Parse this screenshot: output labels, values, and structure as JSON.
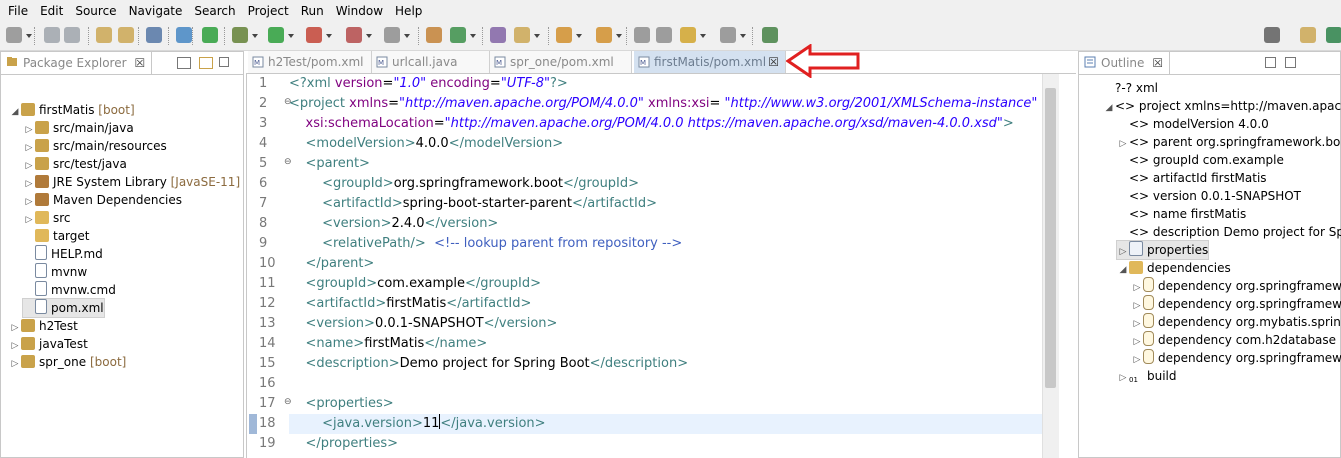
{
  "menu": [
    "File",
    "Edit",
    "Source",
    "Navigate",
    "Search",
    "Project",
    "Run",
    "Window",
    "Help"
  ],
  "package_explorer": {
    "title": "Package Explorer",
    "close": "☒",
    "items": [
      {
        "label": "firstMatis",
        "deco": " [boot]",
        "twisty": "◢",
        "icon": "project-icon"
      },
      {
        "label": "src/main/java",
        "deco": "",
        "twisty": "▷",
        "icon": "source-folder-icon"
      },
      {
        "label": "src/main/resources",
        "deco": "",
        "twisty": "▷",
        "icon": "source-folder-icon"
      },
      {
        "label": "src/test/java",
        "deco": "",
        "twisty": "▷",
        "icon": "source-folder-icon"
      },
      {
        "label": "JRE System Library",
        "deco": " [JavaSE-11]",
        "twisty": "▷",
        "icon": "library-icon"
      },
      {
        "label": "Maven Dependencies",
        "deco": "",
        "twisty": "▷",
        "icon": "library-icon"
      },
      {
        "label": "src",
        "deco": "",
        "twisty": "▷",
        "icon": "folder-icon"
      },
      {
        "label": "target",
        "deco": "",
        "twisty": "",
        "icon": "folder-icon"
      },
      {
        "label": "HELP.md",
        "deco": "",
        "twisty": "",
        "icon": "file-icon"
      },
      {
        "label": "mvnw",
        "deco": "",
        "twisty": "",
        "icon": "file-icon"
      },
      {
        "label": "mvnw.cmd",
        "deco": "",
        "twisty": "",
        "icon": "file-icon"
      },
      {
        "label": "pom.xml",
        "deco": "",
        "twisty": "",
        "icon": "xml-file-icon"
      },
      {
        "label": "h2Test",
        "deco": "",
        "twisty": "▷",
        "icon": "project-icon"
      },
      {
        "label": "javaTest",
        "deco": "",
        "twisty": "▷",
        "icon": "project-icon"
      },
      {
        "label": "spr_one",
        "deco": " [boot]",
        "twisty": "▷",
        "icon": "project-icon"
      }
    ]
  },
  "editor_tabs": [
    {
      "label": "h2Test/pom.xml",
      "active": false
    },
    {
      "label": "urlcall.java",
      "active": false
    },
    {
      "label": "spr_one/pom.xml",
      "active": false
    },
    {
      "label": "firstMatis/pom.xml",
      "active": true
    }
  ],
  "editor_tab_close": "☒",
  "code_lines": [
    {
      "n": "1",
      "fold": "",
      "segs": [
        [
          "t",
          "<?xml "
        ],
        [
          "a",
          "version"
        ],
        [
          "",
          "="
        ],
        [
          "v",
          "\"1.0\""
        ],
        [
          "",
          " "
        ],
        [
          "a",
          "encoding"
        ],
        [
          "",
          "="
        ],
        [
          "v",
          "\"UTF-8\""
        ],
        [
          "t",
          "?>"
        ]
      ]
    },
    {
      "n": "2",
      "fold": "⊖",
      "segs": [
        [
          "t",
          "<project "
        ],
        [
          "a",
          "xmlns"
        ],
        [
          "",
          "="
        ],
        [
          "v",
          "\"http://maven.apache.org/POM/4.0.0\""
        ],
        [
          "",
          " "
        ],
        [
          "a",
          "xmlns:xsi"
        ],
        [
          "",
          "="
        ],
        [
          "v",
          " \"http://www.w3.org/2001/XMLSchema-instance\""
        ]
      ]
    },
    {
      "n": "3",
      "fold": "",
      "segs": [
        [
          "",
          "    "
        ],
        [
          "a",
          "xsi:schemaLocation"
        ],
        [
          "",
          "="
        ],
        [
          "v",
          "\"http://maven.apache.org/POM/4.0.0 https://maven.apache.org/xsd/maven-4.0.0.xsd\""
        ],
        [
          "t",
          ">"
        ]
      ]
    },
    {
      "n": "4",
      "fold": "",
      "segs": [
        [
          "",
          "    "
        ],
        [
          "t",
          "<modelVersion>"
        ],
        [
          "",
          "4.0.0"
        ],
        [
          "t",
          "</modelVersion>"
        ]
      ]
    },
    {
      "n": "5",
      "fold": "⊖",
      "segs": [
        [
          "",
          "    "
        ],
        [
          "t",
          "<parent>"
        ]
      ]
    },
    {
      "n": "6",
      "fold": "",
      "segs": [
        [
          "",
          "        "
        ],
        [
          "t",
          "<groupId>"
        ],
        [
          "",
          "org.springframework.boot"
        ],
        [
          "t",
          "</groupId>"
        ]
      ]
    },
    {
      "n": "7",
      "fold": "",
      "segs": [
        [
          "",
          "        "
        ],
        [
          "t",
          "<artifactId>"
        ],
        [
          "",
          "spring-boot-starter-parent"
        ],
        [
          "t",
          "</artifactId>"
        ]
      ]
    },
    {
      "n": "8",
      "fold": "",
      "segs": [
        [
          "",
          "        "
        ],
        [
          "t",
          "<version>"
        ],
        [
          "",
          "2.4.0"
        ],
        [
          "t",
          "</version>"
        ]
      ]
    },
    {
      "n": "9",
      "fold": "",
      "segs": [
        [
          "",
          "        "
        ],
        [
          "t",
          "<relativePath/>"
        ],
        [
          "",
          " "
        ],
        [
          "c",
          " <!-- lookup parent from repository -->"
        ]
      ]
    },
    {
      "n": "10",
      "fold": "",
      "segs": [
        [
          "",
          "    "
        ],
        [
          "t",
          "</parent>"
        ]
      ]
    },
    {
      "n": "11",
      "fold": "",
      "segs": [
        [
          "",
          "    "
        ],
        [
          "t",
          "<groupId>"
        ],
        [
          "",
          "com.example"
        ],
        [
          "t",
          "</groupId>"
        ]
      ]
    },
    {
      "n": "12",
      "fold": "",
      "segs": [
        [
          "",
          "    "
        ],
        [
          "t",
          "<artifactId>"
        ],
        [
          "",
          "firstMatis"
        ],
        [
          "t",
          "</artifactId>"
        ]
      ]
    },
    {
      "n": "13",
      "fold": "",
      "segs": [
        [
          "",
          "    "
        ],
        [
          "t",
          "<version>"
        ],
        [
          "",
          "0.0.1-SNAPSHOT"
        ],
        [
          "t",
          "</version>"
        ]
      ]
    },
    {
      "n": "14",
      "fold": "",
      "segs": [
        [
          "",
          "    "
        ],
        [
          "t",
          "<name>"
        ],
        [
          "",
          "firstMatis"
        ],
        [
          "t",
          "</name>"
        ]
      ]
    },
    {
      "n": "15",
      "fold": "",
      "segs": [
        [
          "",
          "    "
        ],
        [
          "t",
          "<description>"
        ],
        [
          "",
          "Demo project for Spring Boot"
        ],
        [
          "t",
          "</description>"
        ]
      ]
    },
    {
      "n": "16",
      "fold": "",
      "segs": []
    },
    {
      "n": "17",
      "fold": "⊖",
      "segs": [
        [
          "",
          "    "
        ],
        [
          "t",
          "<properties>"
        ]
      ]
    },
    {
      "n": "18",
      "fold": "",
      "segs": [
        [
          "",
          "        "
        ],
        [
          "t",
          "<java.version>"
        ],
        [
          "",
          "11"
        ],
        [
          "caret",
          ""
        ],
        [
          "t",
          "</java.version>"
        ]
      ],
      "current": true
    },
    {
      "n": "19",
      "fold": "",
      "segs": [
        [
          "",
          "    "
        ],
        [
          "t",
          "</properties>"
        ]
      ]
    }
  ],
  "outline": {
    "title": "Outline",
    "close": "☒",
    "items": [
      {
        "label": "?-? xml",
        "twisty": "",
        "indent": 0
      },
      {
        "label": "<> project xmlns=http://maven.apache.org/",
        "twisty": "◢",
        "indent": 0
      },
      {
        "label": "<> modelVersion  4.0.0",
        "twisty": "",
        "indent": 1
      },
      {
        "label": "<> parent  org.springframework.boot : sp",
        "twisty": "▷",
        "indent": 1
      },
      {
        "label": "<> groupId  com.example",
        "twisty": "",
        "indent": 1
      },
      {
        "label": "<> artifactId  firstMatis",
        "twisty": "",
        "indent": 1
      },
      {
        "label": "<> version  0.0.1-SNAPSHOT",
        "twisty": "",
        "indent": 1
      },
      {
        "label": "<> name  firstMatis",
        "twisty": "",
        "indent": 1
      },
      {
        "label": "<> description  Demo project for Spring",
        "twisty": "",
        "indent": 1
      },
      {
        "label": "properties",
        "twisty": "▷",
        "indent": 1,
        "selected": true
      },
      {
        "label": "dependencies",
        "twisty": "◢",
        "indent": 1
      },
      {
        "label": "dependency  org.springframework.",
        "twisty": "▷",
        "indent": 2
      },
      {
        "label": "dependency  org.springframework.",
        "twisty": "▷",
        "indent": 2
      },
      {
        "label": "dependency  org.mybatis.spring.bo",
        "twisty": "▷",
        "indent": 2
      },
      {
        "label": "dependency  com.h2database : h2",
        "twisty": "▷",
        "indent": 2
      },
      {
        "label": "dependency  org.springframework.",
        "twisty": "▷",
        "indent": 2
      },
      {
        "label": "build",
        "twisty": "▷",
        "indent": 1
      }
    ]
  },
  "colors": {
    "accent_arrow": "#e02020",
    "active_tab": "#d4e1f0"
  }
}
